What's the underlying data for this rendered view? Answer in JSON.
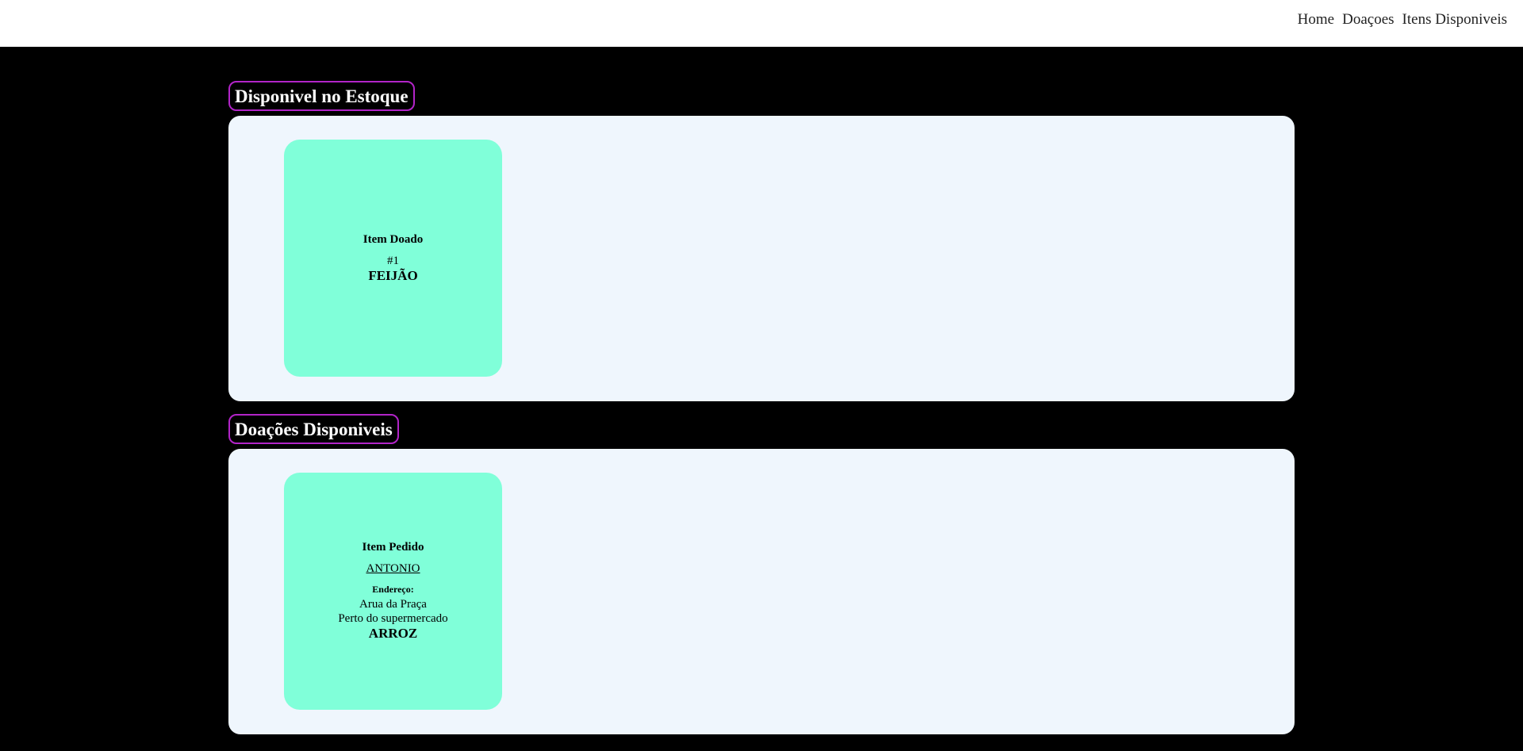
{
  "nav": {
    "items": [
      "Home",
      "Doaçoes",
      "Itens Disponiveis"
    ]
  },
  "stock_section": {
    "title": "Disponivel no Estoque",
    "card": {
      "heading": "Item Doado",
      "number": "#1",
      "item": "FEIJÃO"
    }
  },
  "donations_section": {
    "title": "Doações Disponiveis",
    "card": {
      "heading": "Item Pedido",
      "person": "ANTONIO",
      "address_label": "Endereço:",
      "address_line1": "Arua da Praça",
      "address_line2": "Perto do supermercado",
      "item": "ARROZ"
    }
  },
  "colors": {
    "background": "#000000",
    "header": "#ffffff",
    "panel": "#eff6fd",
    "card": "#80ffd9",
    "title_border": "#b224c8"
  }
}
